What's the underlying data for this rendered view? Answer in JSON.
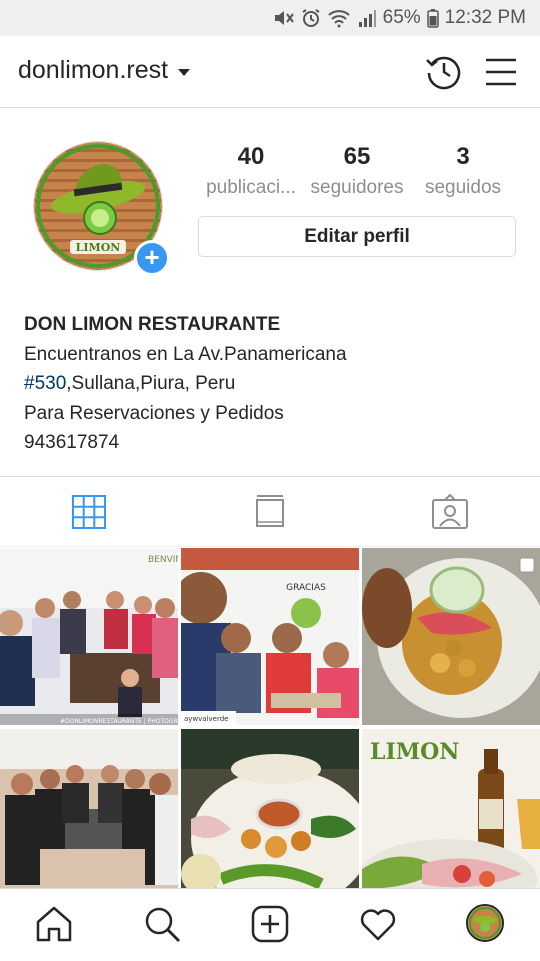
{
  "status_bar": {
    "battery": "65%",
    "time": "12:32 PM",
    "icons": [
      "mute-icon",
      "alarm-icon",
      "wifi-icon",
      "signal-icon",
      "battery-icon"
    ]
  },
  "header": {
    "username": "donlimon.rest",
    "icons": [
      "history-icon",
      "menu-icon"
    ]
  },
  "profile": {
    "avatar_text": "LIMON",
    "stats": [
      {
        "value": "40",
        "label": "publicaci..."
      },
      {
        "value": "65",
        "label": "seguidores"
      },
      {
        "value": "3",
        "label": "seguidos"
      }
    ],
    "edit_button": "Editar perfil"
  },
  "bio": {
    "name": "DON LIMON RESTAURANTE",
    "line1": "Encuentranos en La Av.Panamericana",
    "hashtag": "#530",
    "line2_rest": ",Sullana,Piura, Peru",
    "line3": "Para Reservaciones y Pedidos",
    "phone": "943617874"
  },
  "tabs": [
    "grid-icon",
    "feed-icon",
    "tagged-icon"
  ],
  "posts": [
    {
      "caption": "#DONLIMONRESTAURANTE | PHOTOGR",
      "sign": "BENVIN"
    },
    {
      "caption": "aywvalverde",
      "sign": "GRACIAS"
    },
    {
      "caption": ""
    },
    {
      "caption": ""
    },
    {
      "caption": ""
    },
    {
      "caption": "",
      "sign": "LIMON"
    }
  ],
  "bottom_nav": [
    "home-icon",
    "search-icon",
    "add-post-icon",
    "activity-icon",
    "profile-icon"
  ],
  "colors": {
    "accent": "#3897f0",
    "hashtag": "#003569",
    "muted": "#8e8e8e"
  }
}
